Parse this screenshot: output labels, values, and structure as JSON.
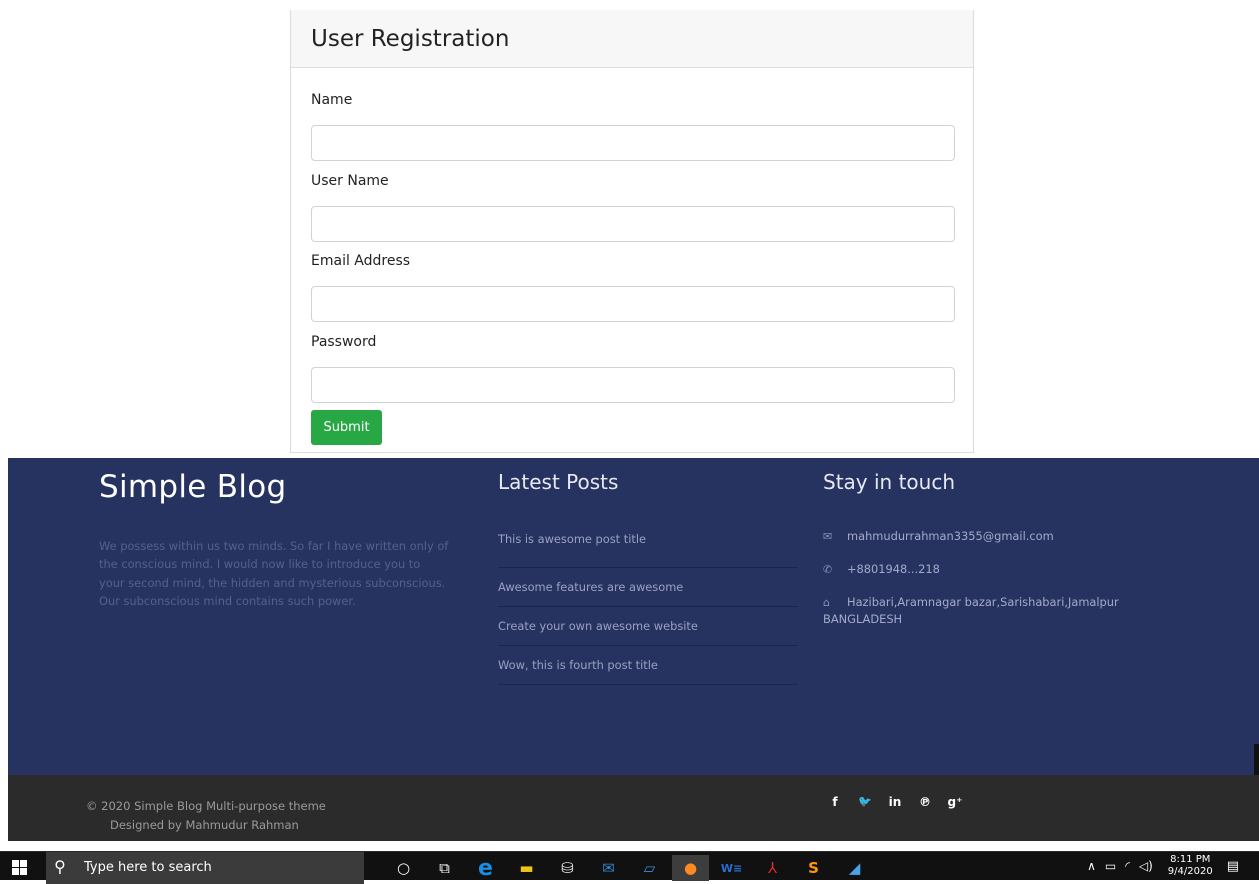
{
  "registration": {
    "title": "User Registration",
    "fields": [
      {
        "label": "Name",
        "value": ""
      },
      {
        "label": "User Name",
        "value": ""
      },
      {
        "label": "Email Address",
        "value": ""
      },
      {
        "label": "Password",
        "value": ""
      }
    ],
    "submit_label": "Submit"
  },
  "footer": {
    "brand": "Simple Blog",
    "about": "We possess within us two minds. So far I have written only of the conscious mind. I would now like to introduce you to your second mind, the hidden and mysterious subconscious. Our subconscious mind contains such power.",
    "latest_posts": {
      "heading": "Latest Posts",
      "items": [
        "This is awesome post title",
        "Awesome features are awesome",
        "Create your own awesome website",
        "Wow, this is fourth post title"
      ]
    },
    "contact": {
      "heading": "Stay in touch",
      "email": "mahmudurrahman3355@gmail.com",
      "phone": "+8801948...218",
      "address": "Hazibari,Aramnagar bazar,Sarishabari,Jamalpur BANGLADESH"
    },
    "colors": {
      "background": "#263260",
      "bar": "#2b2b2b"
    }
  },
  "bottom_bar": {
    "copyright": "© 2020 Simple Blog Multi-purpose theme",
    "designer": "Designed by Mahmudur Rahman",
    "social_icons": [
      "facebook-icon",
      "twitter-icon",
      "linkedin-icon",
      "pinterest-icon",
      "google-plus-icon"
    ],
    "social_glyphs": [
      "f",
      "🐦",
      "in",
      "℗",
      "g⁺"
    ]
  },
  "taskbar": {
    "search_placeholder": "Type here to search",
    "time": "8:11 PM",
    "date": "9/4/2020"
  }
}
